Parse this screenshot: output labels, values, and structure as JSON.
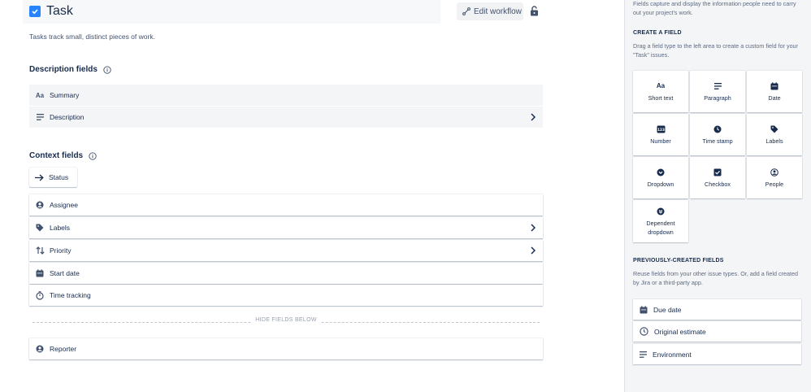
{
  "header": {
    "title": "Task",
    "edit_workflow_label": "Edit workflow",
    "description": "Tasks track small, distinct pieces of work."
  },
  "description_fields": {
    "title": "Description fields",
    "items": [
      {
        "label": "Summary",
        "icon": "short-text-icon"
      },
      {
        "label": "Description",
        "icon": "paragraph-icon"
      }
    ]
  },
  "context_fields": {
    "title": "Context fields",
    "status_label": "Status",
    "items": [
      {
        "label": "Assignee",
        "icon": "person-icon"
      },
      {
        "label": "Labels",
        "icon": "tag-icon"
      },
      {
        "label": "Priority",
        "icon": "priority-icon"
      },
      {
        "label": "Start date",
        "icon": "calendar-icon"
      },
      {
        "label": "Time tracking",
        "icon": "stopwatch-icon"
      }
    ],
    "hide_label": "HIDE FIELDS BELOW",
    "hidden_items": [
      {
        "label": "Reporter",
        "icon": "person-icon"
      }
    ]
  },
  "sidebar": {
    "intro": "Fields capture and display the information people need to carry out your project's work.",
    "create_heading": "CREATE A FIELD",
    "create_text": "Drag a field type to the left area to create a custom field for your \"Task\" issues.",
    "field_types": [
      {
        "label": "Short text",
        "icon": "short-text-icon"
      },
      {
        "label": "Paragraph",
        "icon": "paragraph-icon"
      },
      {
        "label": "Date",
        "icon": "calendar-icon"
      },
      {
        "label": "Number",
        "icon": "number-icon"
      },
      {
        "label": "Time stamp",
        "icon": "clock-icon"
      },
      {
        "label": "Labels",
        "icon": "tag-icon"
      },
      {
        "label": "Dropdown",
        "icon": "dropdown-icon"
      },
      {
        "label": "Checkbox",
        "icon": "checkbox-icon"
      },
      {
        "label": "People",
        "icon": "person-icon"
      },
      {
        "label": "Dependent dropdown",
        "icon": "dependent-dropdown-icon"
      }
    ],
    "prev_heading": "PREVIOUSLY-CREATED FIELDS",
    "prev_text": "Reuse fields from your other issue types. Or, add a field created by Jira or a third-party app.",
    "prev_fields": [
      {
        "label": "Due date",
        "icon": "calendar-icon"
      },
      {
        "label": "Original estimate",
        "icon": "clock-outline-icon"
      },
      {
        "label": "Environment",
        "icon": "paragraph-icon"
      }
    ]
  },
  "colors": {
    "accent": "#2684ff",
    "text": "#172b4d",
    "sidebar_bg": "#f4f5f7"
  }
}
